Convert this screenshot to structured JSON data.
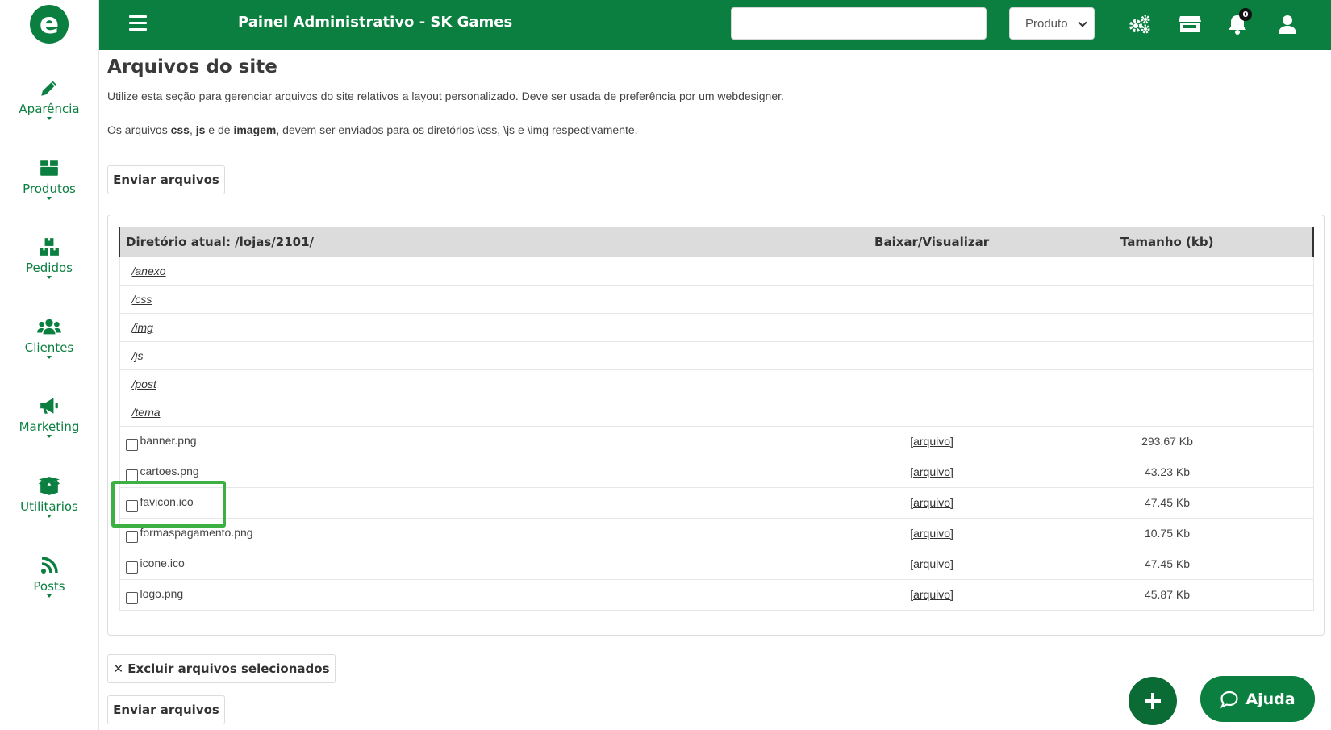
{
  "sidebar": {
    "logo": "e",
    "items": [
      {
        "label": "Aparência",
        "icon": "pencil-icon"
      },
      {
        "label": "Produtos",
        "icon": "box-icon"
      },
      {
        "label": "Pedidos",
        "icon": "boxes-icon"
      },
      {
        "label": "Clientes",
        "icon": "users-icon"
      },
      {
        "label": "Marketing",
        "icon": "megaphone-icon"
      },
      {
        "label": "Utilitarios",
        "icon": "box-open-icon"
      },
      {
        "label": "Posts",
        "icon": "rss-icon"
      }
    ]
  },
  "topbar": {
    "title": "Painel Administrativo - SK Games",
    "search_value": "",
    "select_value": "Produto",
    "notification_count": "0"
  },
  "main": {
    "title": "Arquivos do site",
    "description": "Utilize esta seção para gerenciar arquivos do site relativos a layout personalizado. Deve ser usada de preferência por um webdesigner.",
    "note_prefix": "Os arquivos ",
    "note_css": "css",
    "note_sep1": ", ",
    "note_js": "js",
    "note_sep2": " e de ",
    "note_img": "imagem",
    "note_suffix": ", devem ser enviados para os diretórios \\css, \\js e \\img respectivamente.",
    "upload_button": "Enviar arquivos",
    "delete_button": "✕ Excluir arquivos selecionados",
    "upload_button_bottom": "Enviar arquivos"
  },
  "table": {
    "headers": [
      "Diretório atual: /lojas/2101/",
      "Baixar/Visualizar",
      "Tamanho (kb)"
    ],
    "directories": [
      "/anexo",
      "/css",
      "/img",
      "/js",
      "/post",
      "/tema"
    ],
    "files": [
      {
        "name": "banner.png",
        "link": "[arquivo]",
        "size": "293.67 Kb"
      },
      {
        "name": "cartoes.png",
        "link": "[arquivo]",
        "size": "43.23 Kb"
      },
      {
        "name": "favicon.ico",
        "link": "[arquivo]",
        "size": "47.45 Kb"
      },
      {
        "name": "formaspagamento.png",
        "link": "[arquivo]",
        "size": "10.75 Kb"
      },
      {
        "name": "icone.ico",
        "link": "[arquivo]",
        "size": "47.45 Kb"
      },
      {
        "name": "logo.png",
        "link": "[arquivo]",
        "size": "45.87 Kb"
      }
    ]
  },
  "help_button": "Ajuda",
  "colors": {
    "brand_green": "#0a7f3f",
    "highlight": "#3cb043"
  }
}
